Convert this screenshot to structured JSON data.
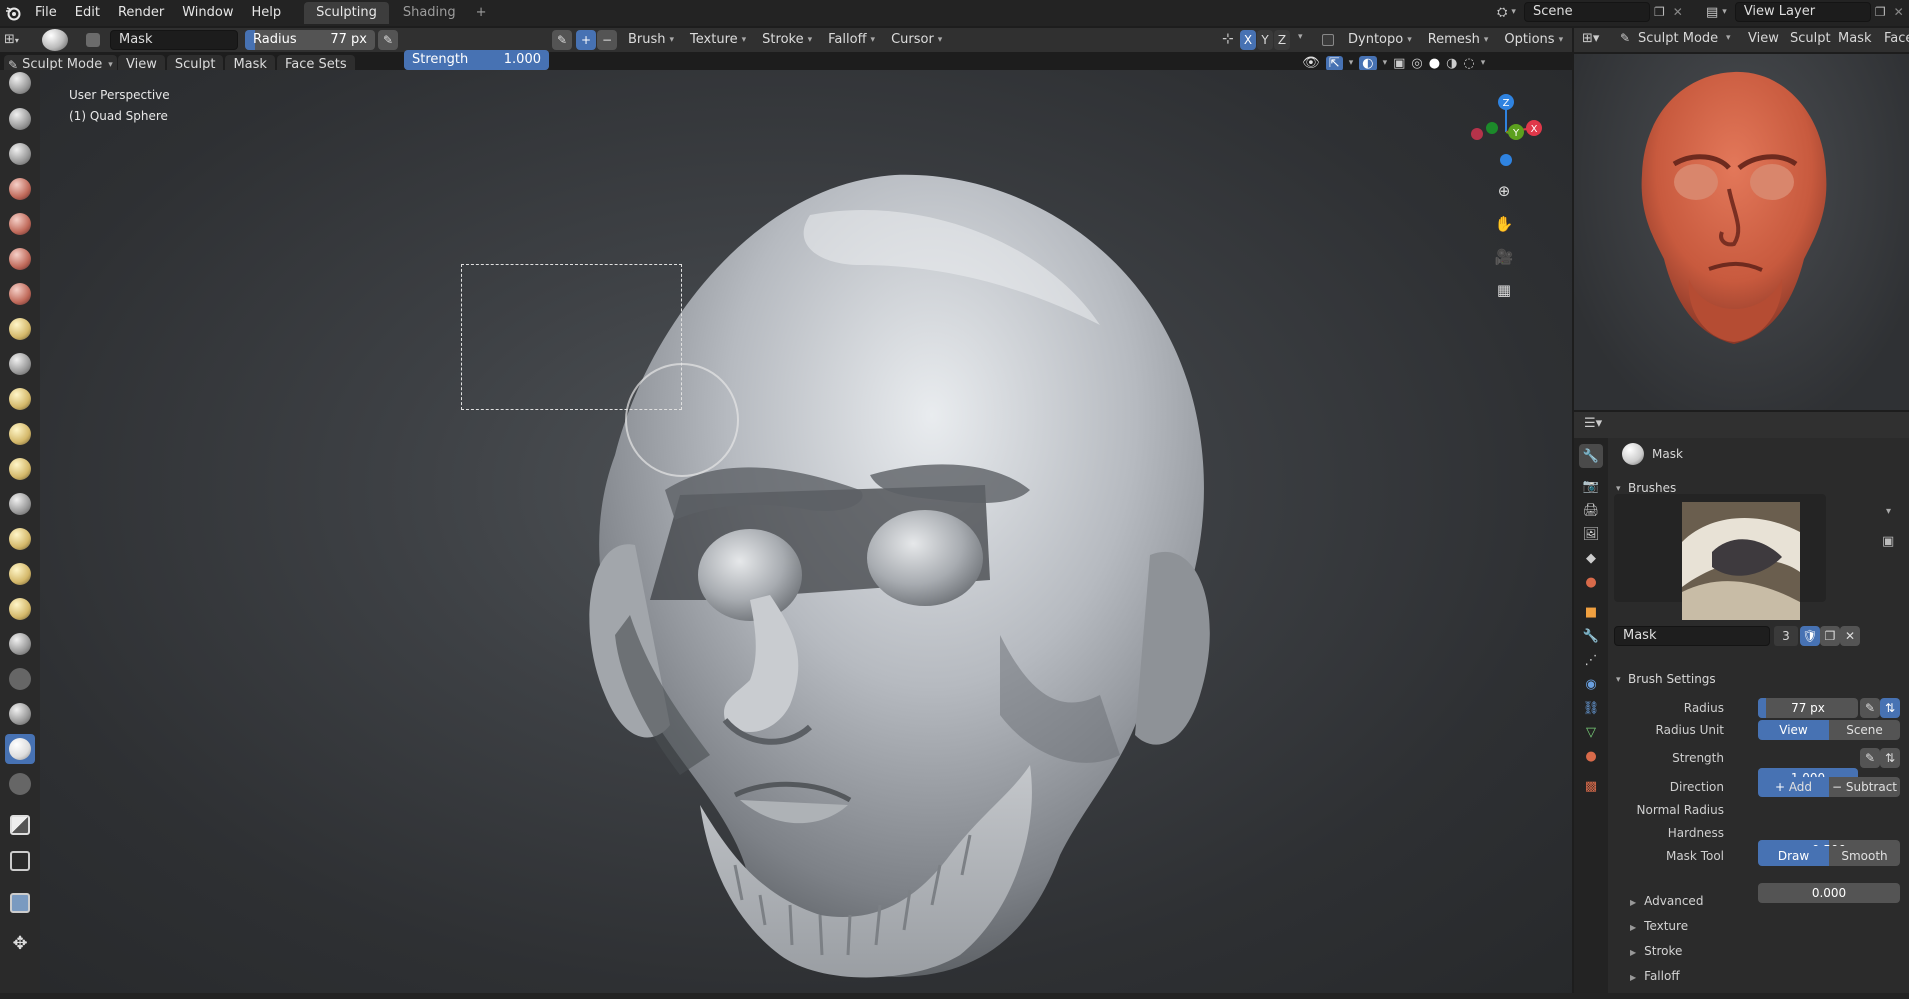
{
  "topbar": {
    "menus": [
      "File",
      "Edit",
      "Render",
      "Window",
      "Help"
    ],
    "tabs": [
      {
        "label": "Sculpting",
        "active": true
      },
      {
        "label": "Shading",
        "active": false
      }
    ],
    "add_tab": "+",
    "scene_label": "Scene",
    "view_layer_label": "View Layer"
  },
  "tool_header": {
    "brush_name": "Mask",
    "radius_label": "Radius",
    "radius_value": "77 px",
    "strength_label": "Strength",
    "strength_value": "1.000",
    "strength_fraction": 1.0,
    "plus": "+",
    "minus": "−",
    "menus": [
      "Brush",
      "Texture",
      "Stroke",
      "Falloff",
      "Cursor"
    ],
    "axes": [
      "X",
      "Y",
      "Z"
    ],
    "dyntopo": "Dyntopo",
    "remesh": "Remesh",
    "options": "Options"
  },
  "view_header": {
    "mode": "Sculpt Mode",
    "menus": [
      "View",
      "Sculpt",
      "Mask",
      "Face Sets"
    ]
  },
  "viewport": {
    "perspective": "User Perspective",
    "object": "(1) Quad Sphere",
    "gizmo_z": "Z",
    "gizmo_y": "Y",
    "gizmo_x": "X"
  },
  "preview_header": {
    "mode": "Sculpt Mode",
    "menus": [
      "View",
      "Sculpt",
      "Mask",
      "Face"
    ]
  },
  "properties": {
    "tool_name": "Mask",
    "brushes_title": "Brushes",
    "brush_datablock": "Mask",
    "brush_users": "3",
    "brush_settings_title": "Brush Settings",
    "radius_label": "Radius",
    "radius_value": "77 px",
    "radius_unit_label": "Radius Unit",
    "radius_unit_options": [
      "View",
      "Scene"
    ],
    "strength_label": "Strength",
    "strength_value": "1.000",
    "direction_label": "Direction",
    "direction_options": [
      "Add",
      "Subtract"
    ],
    "normal_radius_label": "Normal Radius",
    "normal_radius_value": "0.500",
    "normal_radius_fraction": 0.5,
    "hardness_label": "Hardness",
    "hardness_value": "0.000",
    "hardness_fraction": 0.0,
    "mask_tool_label": "Mask Tool",
    "mask_tool_options": [
      "Draw",
      "Smooth"
    ],
    "collapsed_panels": [
      "Advanced",
      "Texture",
      "Stroke",
      "Falloff"
    ]
  },
  "colors": {
    "accent": "#4772b3",
    "header": "#303030",
    "panel": "#2b2b2b",
    "gizmo_x": "#e0384a",
    "gizmo_y": "#5ca01e",
    "gizmo_z": "#2f83e0",
    "clay": "#c85a3e"
  }
}
